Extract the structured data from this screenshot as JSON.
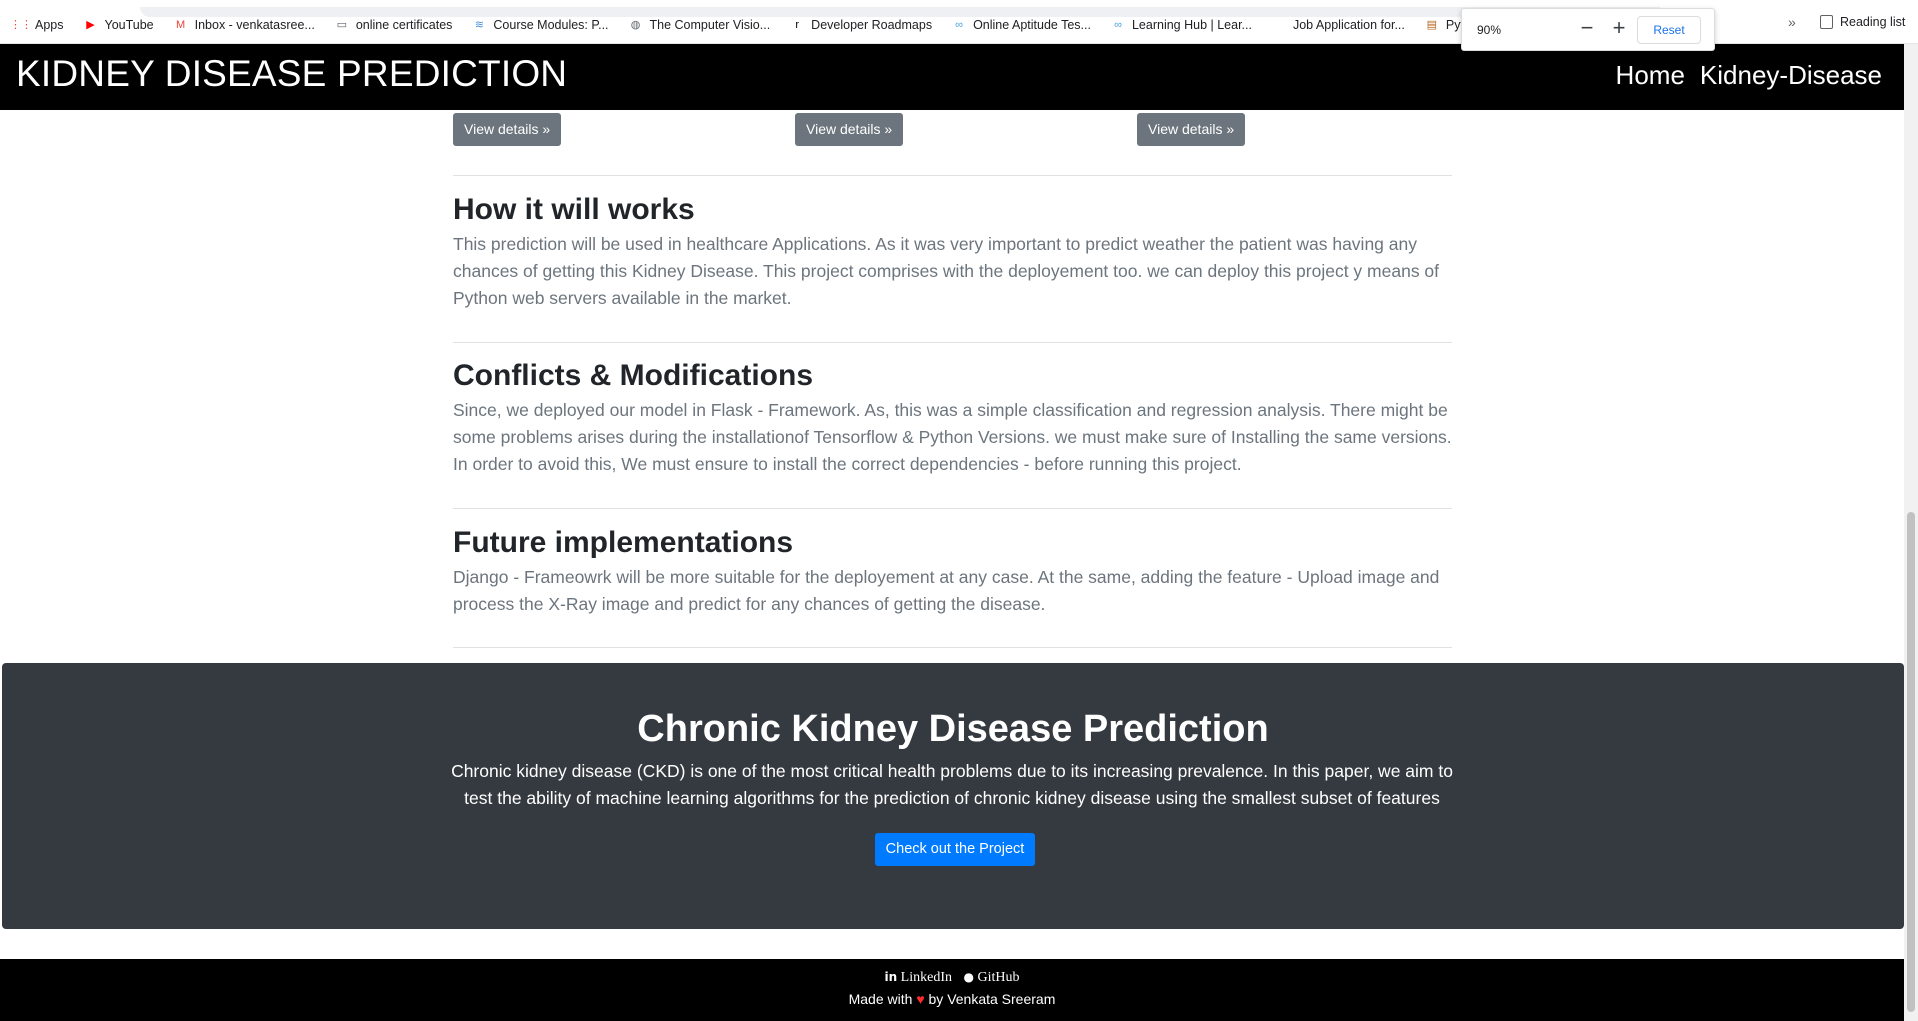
{
  "browser": {
    "bookmarks": [
      {
        "icon": "apps-grid-icon",
        "label": "Apps",
        "glyph": "⋮⋮",
        "color": "#ea4335"
      },
      {
        "icon": "youtube-icon",
        "label": "YouTube",
        "glyph": "▶",
        "color": "#ff0000"
      },
      {
        "icon": "gmail-icon",
        "label": "Inbox - venkatasree...",
        "glyph": "M",
        "color": "#ea4335"
      },
      {
        "icon": "certificate-icon",
        "label": "online certificates",
        "glyph": "▭",
        "color": "#5f6368"
      },
      {
        "icon": "course-icon",
        "label": "Course Modules: P...",
        "glyph": "≋",
        "color": "#4a90d9"
      },
      {
        "icon": "globe-icon",
        "label": "The Computer Visio...",
        "glyph": "◍",
        "color": "#5f6368"
      },
      {
        "icon": "roadmap-icon",
        "label": "Developer Roadmaps",
        "glyph": "r",
        "color": "#000000"
      },
      {
        "icon": "aptitude-icon",
        "label": "Online Aptitude Tes...",
        "glyph": "∞",
        "color": "#4aa3df"
      },
      {
        "icon": "learning-hub-icon",
        "label": "Learning Hub | Lear...",
        "glyph": "∞",
        "color": "#4aa3df"
      },
      {
        "icon": "job-icon",
        "label": "Job Application for...",
        "glyph": " ",
        "color": "#ffffff"
      },
      {
        "icon": "python-icon",
        "label": "Python tutoria",
        "glyph": "▤",
        "color": "#b5651d"
      }
    ],
    "more_label": "»",
    "reading_list": "Reading list",
    "zoom": {
      "level": "90%",
      "minus": "−",
      "plus": "+",
      "reset": "Reset"
    }
  },
  "navbar": {
    "brand": "KIDNEY DISEASE PREDICTION",
    "links": [
      "Home",
      "Kidney-Disease"
    ]
  },
  "details_buttons": [
    "View details »",
    "View details »",
    "View details »"
  ],
  "features": [
    {
      "title": "How it will works",
      "text": "This prediction will be used in healthcare Applications. As it was very important to predict weather the patient was having any chances of getting this Kidney Disease. This project comprises with the deployement too. we can deploy this project y means of Python web servers available in the market."
    },
    {
      "title": "Conflicts & Modifications",
      "text": "Since, we deployed our model in Flask - Framework. As, this was a simple classification and regression analysis. There might be some problems arises during the installationof Tensorflow & Python Versions. we must make sure of Installing the same versions. In order to avoid this, We must ensure to install the correct dependencies - before running this project."
    },
    {
      "title": "Future implementations",
      "text": "Django - Frameowrk will be more suitable for the deployement at any case. At the same, adding the feature - Upload image and process the X-Ray image and predict for any chances of getting the disease."
    }
  ],
  "jumbotron": {
    "title": "Chronic Kidney Disease Prediction",
    "text": "Chronic kidney disease (CKD) is one of the most critical health problems due to its increasing prevalence. In this paper, we aim to test the ability of machine learning algorithms for the prediction of chronic kidney disease using the smallest subset of features",
    "button": "Check out the Project"
  },
  "footer": {
    "linkedin": "LinkedIn",
    "github": "GitHub",
    "made_with": "Made with",
    "heart": "♥",
    "by": "by Venkata Sreeram"
  },
  "colors": {
    "navbar_bg": "#000000",
    "jumbotron_bg": "#343a40",
    "primary_button": "#007bff",
    "secondary_button": "#6c757d",
    "heart": "#ff2a2a"
  }
}
